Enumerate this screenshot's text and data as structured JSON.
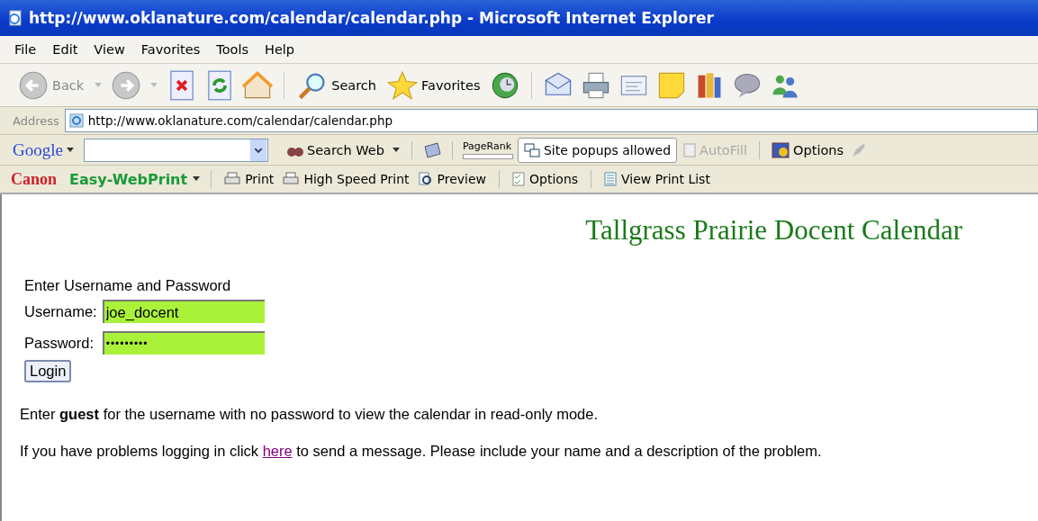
{
  "window": {
    "title": "http://www.oklanature.com/calendar/calendar.php - Microsoft Internet Explorer"
  },
  "menu": [
    "File",
    "Edit",
    "View",
    "Favorites",
    "Tools",
    "Help"
  ],
  "toolbar": {
    "back": "Back",
    "search": "Search",
    "favorites": "Favorites"
  },
  "address": {
    "label": "Address",
    "value": "http://www.oklanature.com/calendar/calendar.php"
  },
  "google_bar": {
    "logo": "Google",
    "search_button": "Search Web",
    "pagerank": "PageRank",
    "popups": "Site popups allowed",
    "autofill": {
      "label": "AutoFill",
      "disabled": true
    },
    "options": "Options"
  },
  "print_bar": {
    "brand": "Canon",
    "product": "Easy-WebPrint",
    "buttons": [
      "Print",
      "High Speed Print",
      "Preview",
      "Options",
      "View Print List"
    ]
  },
  "page": {
    "heading": "Tallgrass Prairie Docent Calendar",
    "form_title": "Enter Username and Password",
    "fields": [
      {
        "label": "Username:",
        "value": "joe_docent"
      },
      {
        "label": "Password:",
        "value": "•••••••••"
      }
    ],
    "login_button": "Login",
    "guest_note": "Enter **guest** for the username with no password to view the calendar in read-only mode.",
    "help_before": "If you have problems logging in click",
    "help_link": "here",
    "help_after": "to send a message. Please include your name and a description of the problem."
  }
}
